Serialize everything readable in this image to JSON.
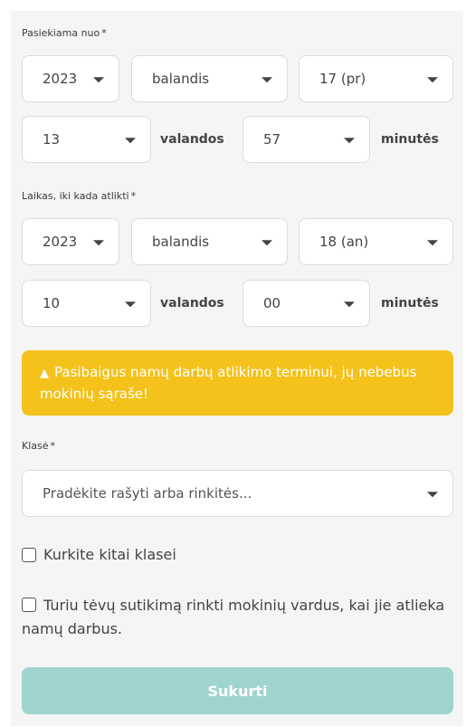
{
  "from_label": "Pasiekiama nuo",
  "required_mark": "*",
  "from": {
    "year": "2023",
    "month": "balandis",
    "day": "17 (pr)",
    "hour": "13",
    "minute": "57"
  },
  "units": {
    "hours": "valandos",
    "minutes": "minutės"
  },
  "deadline_label": "Laikas, iki kada atlikti",
  "deadline": {
    "year": "2023",
    "month": "balandis",
    "day": "18 (an)",
    "hour": "10",
    "minute": "00"
  },
  "warning": {
    "icon": "warning-icon",
    "text": "Pasibaigus namų darbų atlikimo terminui, jų nebebus mokinių sąraše!",
    "color": "#f4c21b"
  },
  "class_label": "Klasė",
  "class_placeholder": "Pradėkite rašyti arba rinkitės...",
  "checkbox_other_class": "Kurkite kitai klasei",
  "checkbox_consent": "Turiu tėvų sutikimą rinkti mokinių vardus, kai jie atlieka namų darbus.",
  "submit_label": "Sukurti",
  "submit_color": "#9fd5ce"
}
